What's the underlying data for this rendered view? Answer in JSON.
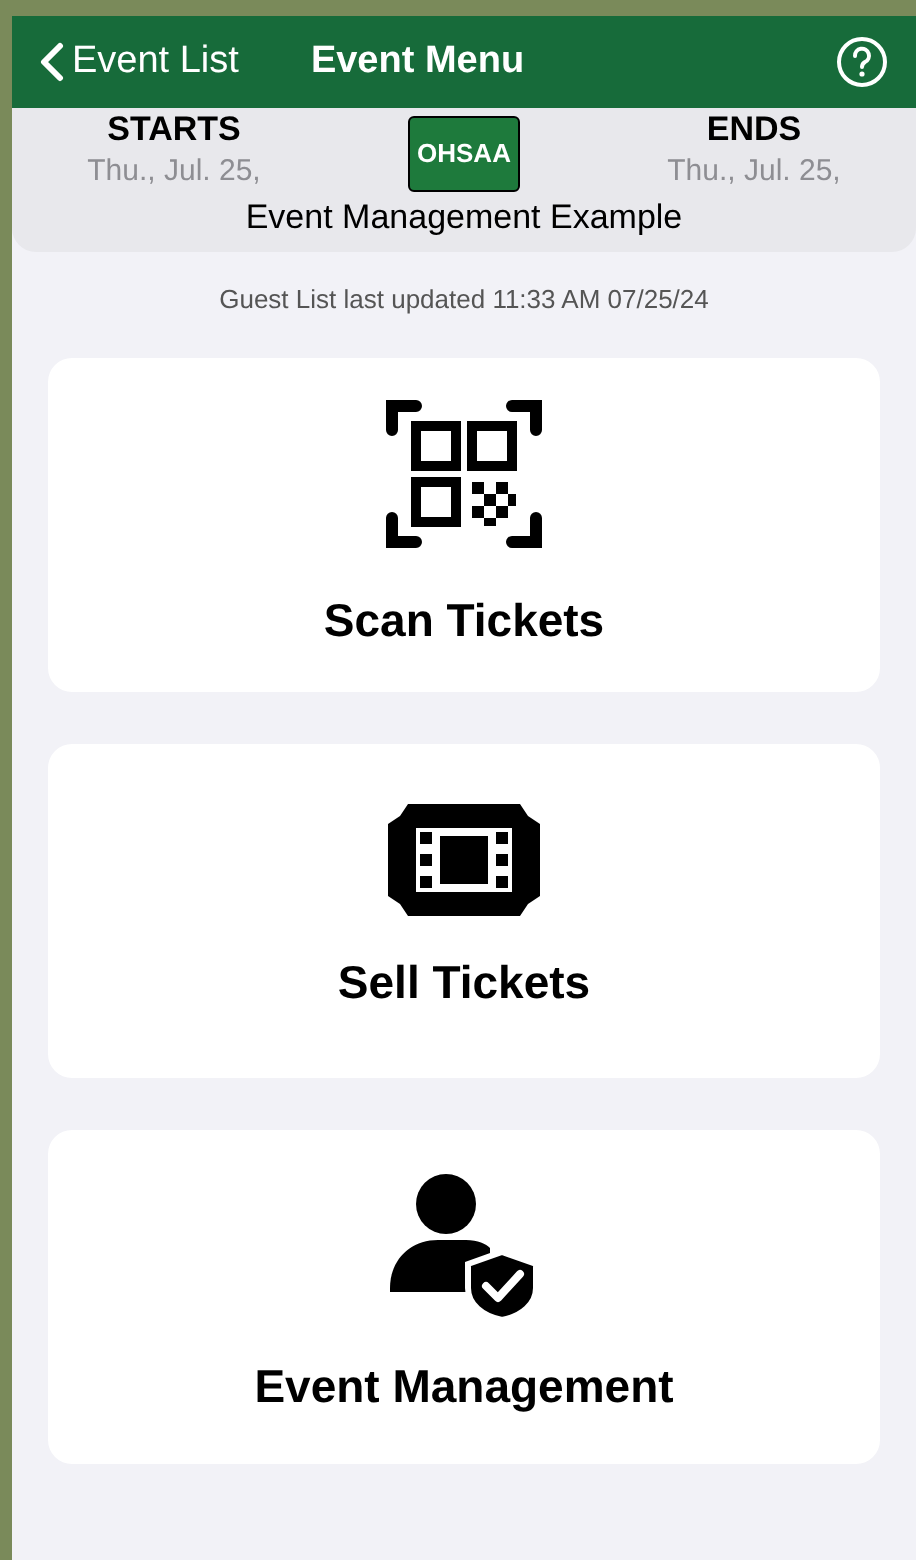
{
  "nav": {
    "back": "Event List",
    "title": "Event Menu"
  },
  "event": {
    "starts_label": "STARTS",
    "starts_date": "Thu., Jul. 25,",
    "logo_text": "OHSAA",
    "ends_label": "ENDS",
    "ends_date": "Thu., Jul. 25,",
    "name": "Event Management Example"
  },
  "updated": "Guest List last updated 11:33 AM 07/25/24",
  "actions": [
    {
      "kind": "scan",
      "label": "Scan Tickets"
    },
    {
      "kind": "sell",
      "label": "Sell Tickets"
    },
    {
      "kind": "manage",
      "label": "Event Management"
    }
  ]
}
